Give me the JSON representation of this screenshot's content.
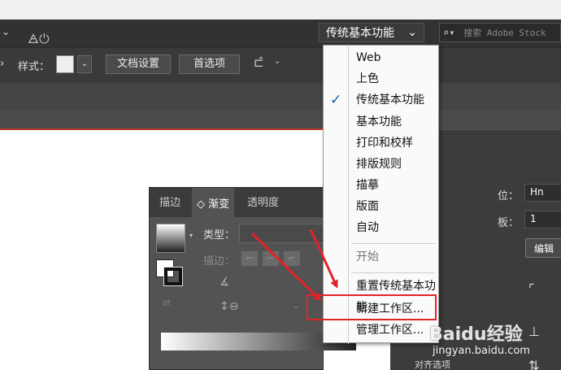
{
  "menubar": {
    "workspace_switcher": "传统基本功能",
    "stock_placeholder": "搜索 Adobe Stock"
  },
  "controlbar": {
    "style_label": "样式：",
    "doc_settings": "文档设置",
    "preferences": "首选项"
  },
  "workspace_menu": {
    "items": [
      "Web",
      "上色",
      "传统基本功能",
      "基本功能",
      "打印和校样",
      "排版规则",
      "描摹",
      "版面",
      "自动"
    ],
    "checked_item": "传统基本功能",
    "start": "开始",
    "reset": "重置传统基本功能",
    "new_workspace": "新建工作区...",
    "manage_workspace": "管理工作区..."
  },
  "gradient_panel": {
    "tabs": [
      "描边",
      "渐变",
      "透明度"
    ],
    "active_tab": "渐变",
    "type_label": "类型：",
    "stroke_label": "描边："
  },
  "right_panel": {
    "position_label": "位：",
    "position_value": "Hn",
    "artboard_label": "板：",
    "artboard_value": "1",
    "edit_button": "编辑",
    "align_label": "对齐选项"
  },
  "watermark": {
    "brand": "Baidu经验",
    "url": "jingyan.baidu.com"
  },
  "colors": {
    "highlight_box": "#e0242a",
    "menu_bg": "#fafafa",
    "check_color": "#1a5ca8"
  }
}
